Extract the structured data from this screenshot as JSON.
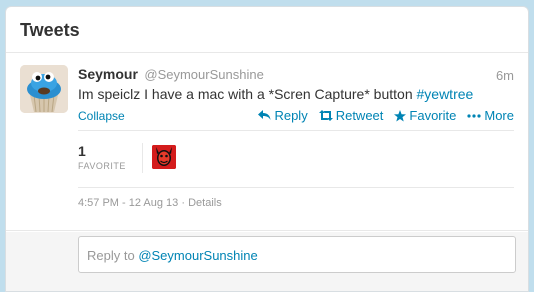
{
  "panel": {
    "title": "Tweets"
  },
  "tweet": {
    "fullname": "Seymour",
    "username": "@SeymourSunshine",
    "timestamp": "6m",
    "text_before": "Im speiclz I have a mac with a *Scren Capture* button ",
    "hashtag": "#yewtree",
    "collapse_label": "Collapse",
    "actions": {
      "reply": "Reply",
      "retweet": "Retweet",
      "favorite": "Favorite",
      "more": "More"
    },
    "stats": {
      "favorite_count": "1",
      "favorite_label": "FAVORITE"
    },
    "meta": {
      "datetime": "4:57 PM - 12 Aug 13",
      "separator": " · ",
      "details": "Details"
    }
  },
  "reply": {
    "prefix": "Reply to ",
    "mention": "@SeymourSunshine"
  },
  "colors": {
    "link": "#0084b4",
    "muted": "#999999",
    "text": "#333333",
    "background": "#c0deed"
  }
}
